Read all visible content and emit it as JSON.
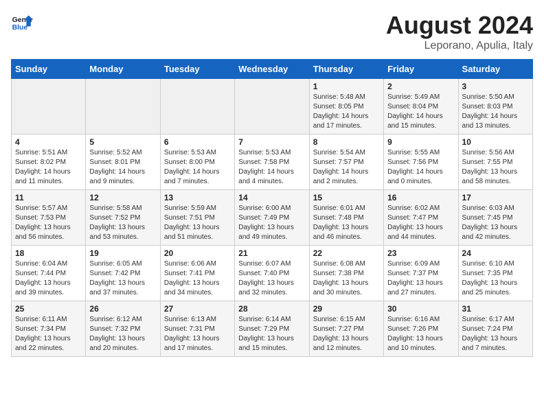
{
  "header": {
    "logo_line1": "General",
    "logo_line2": "Blue",
    "title": "August 2024",
    "subtitle": "Leporano, Apulia, Italy"
  },
  "weekdays": [
    "Sunday",
    "Monday",
    "Tuesday",
    "Wednesday",
    "Thursday",
    "Friday",
    "Saturday"
  ],
  "weeks": [
    [
      {
        "day": "",
        "info": ""
      },
      {
        "day": "",
        "info": ""
      },
      {
        "day": "",
        "info": ""
      },
      {
        "day": "",
        "info": ""
      },
      {
        "day": "1",
        "info": "Sunrise: 5:48 AM\nSunset: 8:05 PM\nDaylight: 14 hours\nand 17 minutes."
      },
      {
        "day": "2",
        "info": "Sunrise: 5:49 AM\nSunset: 8:04 PM\nDaylight: 14 hours\nand 15 minutes."
      },
      {
        "day": "3",
        "info": "Sunrise: 5:50 AM\nSunset: 8:03 PM\nDaylight: 14 hours\nand 13 minutes."
      }
    ],
    [
      {
        "day": "4",
        "info": "Sunrise: 5:51 AM\nSunset: 8:02 PM\nDaylight: 14 hours\nand 11 minutes."
      },
      {
        "day": "5",
        "info": "Sunrise: 5:52 AM\nSunset: 8:01 PM\nDaylight: 14 hours\nand 9 minutes."
      },
      {
        "day": "6",
        "info": "Sunrise: 5:53 AM\nSunset: 8:00 PM\nDaylight: 14 hours\nand 7 minutes."
      },
      {
        "day": "7",
        "info": "Sunrise: 5:53 AM\nSunset: 7:58 PM\nDaylight: 14 hours\nand 4 minutes."
      },
      {
        "day": "8",
        "info": "Sunrise: 5:54 AM\nSunset: 7:57 PM\nDaylight: 14 hours\nand 2 minutes."
      },
      {
        "day": "9",
        "info": "Sunrise: 5:55 AM\nSunset: 7:56 PM\nDaylight: 14 hours\nand 0 minutes."
      },
      {
        "day": "10",
        "info": "Sunrise: 5:56 AM\nSunset: 7:55 PM\nDaylight: 13 hours\nand 58 minutes."
      }
    ],
    [
      {
        "day": "11",
        "info": "Sunrise: 5:57 AM\nSunset: 7:53 PM\nDaylight: 13 hours\nand 56 minutes."
      },
      {
        "day": "12",
        "info": "Sunrise: 5:58 AM\nSunset: 7:52 PM\nDaylight: 13 hours\nand 53 minutes."
      },
      {
        "day": "13",
        "info": "Sunrise: 5:59 AM\nSunset: 7:51 PM\nDaylight: 13 hours\nand 51 minutes."
      },
      {
        "day": "14",
        "info": "Sunrise: 6:00 AM\nSunset: 7:49 PM\nDaylight: 13 hours\nand 49 minutes."
      },
      {
        "day": "15",
        "info": "Sunrise: 6:01 AM\nSunset: 7:48 PM\nDaylight: 13 hours\nand 46 minutes."
      },
      {
        "day": "16",
        "info": "Sunrise: 6:02 AM\nSunset: 7:47 PM\nDaylight: 13 hours\nand 44 minutes."
      },
      {
        "day": "17",
        "info": "Sunrise: 6:03 AM\nSunset: 7:45 PM\nDaylight: 13 hours\nand 42 minutes."
      }
    ],
    [
      {
        "day": "18",
        "info": "Sunrise: 6:04 AM\nSunset: 7:44 PM\nDaylight: 13 hours\nand 39 minutes."
      },
      {
        "day": "19",
        "info": "Sunrise: 6:05 AM\nSunset: 7:42 PM\nDaylight: 13 hours\nand 37 minutes."
      },
      {
        "day": "20",
        "info": "Sunrise: 6:06 AM\nSunset: 7:41 PM\nDaylight: 13 hours\nand 34 minutes."
      },
      {
        "day": "21",
        "info": "Sunrise: 6:07 AM\nSunset: 7:40 PM\nDaylight: 13 hours\nand 32 minutes."
      },
      {
        "day": "22",
        "info": "Sunrise: 6:08 AM\nSunset: 7:38 PM\nDaylight: 13 hours\nand 30 minutes."
      },
      {
        "day": "23",
        "info": "Sunrise: 6:09 AM\nSunset: 7:37 PM\nDaylight: 13 hours\nand 27 minutes."
      },
      {
        "day": "24",
        "info": "Sunrise: 6:10 AM\nSunset: 7:35 PM\nDaylight: 13 hours\nand 25 minutes."
      }
    ],
    [
      {
        "day": "25",
        "info": "Sunrise: 6:11 AM\nSunset: 7:34 PM\nDaylight: 13 hours\nand 22 minutes."
      },
      {
        "day": "26",
        "info": "Sunrise: 6:12 AM\nSunset: 7:32 PM\nDaylight: 13 hours\nand 20 minutes."
      },
      {
        "day": "27",
        "info": "Sunrise: 6:13 AM\nSunset: 7:31 PM\nDaylight: 13 hours\nand 17 minutes."
      },
      {
        "day": "28",
        "info": "Sunrise: 6:14 AM\nSunset: 7:29 PM\nDaylight: 13 hours\nand 15 minutes."
      },
      {
        "day": "29",
        "info": "Sunrise: 6:15 AM\nSunset: 7:27 PM\nDaylight: 13 hours\nand 12 minutes."
      },
      {
        "day": "30",
        "info": "Sunrise: 6:16 AM\nSunset: 7:26 PM\nDaylight: 13 hours\nand 10 minutes."
      },
      {
        "day": "31",
        "info": "Sunrise: 6:17 AM\nSunset: 7:24 PM\nDaylight: 13 hours\nand 7 minutes."
      }
    ]
  ]
}
